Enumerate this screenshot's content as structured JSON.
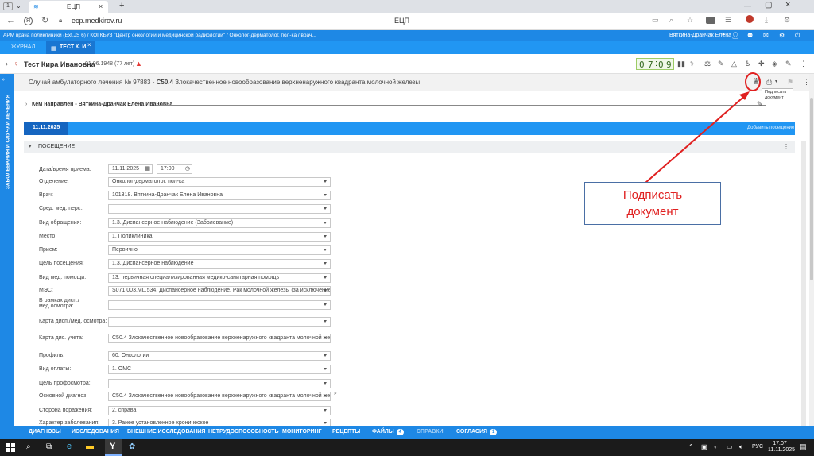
{
  "browser": {
    "tab_count": "1",
    "tab_title": "ЕЦП",
    "url": "ecp.medkirov.ru",
    "page_title": "ЕЦП"
  },
  "app_header": {
    "breadcrumb": "АРМ врача поликлиники (Ext.JS 6) / КОГКБУЗ \"Центр онкологии и медицинской радиологии\" / Онколог-дерматолог. пол-ка / врач...",
    "user": "Вяткина-Дранчак Елена"
  },
  "app_tabs": [
    {
      "label": "ЖУРНАЛ"
    },
    {
      "label": "ТЕСТ К. И."
    }
  ],
  "patient": {
    "name": "Тест Кира Ивановна",
    "birth": "01.06.1948 (77 лет)",
    "timer": [
      "0",
      "7",
      "0",
      "9"
    ]
  },
  "sidebar_label": "ЗАБОЛЕВАНИЯ И СЛУЧАИ ЛЕЧЕНИЯ",
  "case": {
    "title_prefix": "Случай амбулаторного лечения № 97883 - ",
    "diag_code": "C50.4",
    "title_rest": " Злокачественное новообразование верхненаружного квадранта молочной железы",
    "tooltip_line1": "Подписать",
    "tooltip_line2": "документ"
  },
  "referred": {
    "label": "Кем направлен - ",
    "value": "Вяткина-Дранчак Елена Ивановна"
  },
  "visit_bar": {
    "date_tab": "11.11.2025",
    "add_visit": "Добавить посещение"
  },
  "section_title": "ПОСЕЩЕНИЕ",
  "form": {
    "date_label": "Дата/время приема:",
    "date_value": "11.11.2025",
    "time_value": "17:00",
    "rows": [
      {
        "label": "Отделение:",
        "value": "Онколог-дерматолог. пол-ка"
      },
      {
        "label": "Врач:",
        "value": "101318. Вяткина-Дранчак Елена Ивановна"
      },
      {
        "label": "Сред. мед. перс.:",
        "value": ""
      },
      {
        "label": "Вид обращения:",
        "value": "1.3. Диспансерное наблюдение (Заболевание)"
      },
      {
        "label": "Место:",
        "value": "1. Поликлиника"
      },
      {
        "label": "Прием:",
        "value": "Первично"
      },
      {
        "label": "Цель посещения:",
        "value": "1.3. Диспансерное наблюдение"
      },
      {
        "label": "Вид мед. помощи:",
        "value": "13. первичная специализированная медико-санитарная помощь"
      },
      {
        "label": "МЭС:",
        "value": "S071.003.ML.534. Диспансерное наблюдение. Рак молочной железы (за исключением"
      },
      {
        "label": "В рамках дисп./",
        "label2": "мед.осмотра:",
        "value": ""
      },
      {
        "label": "Карта дисп./мед. осмотра:",
        "value": ""
      },
      {
        "label": "Карта дис. учета:",
        "value": "C50.4 Злокачественное новообразование верхненаружного квадранта молочной желе"
      },
      {
        "label": "Профиль:",
        "value": "60. Онкологии"
      },
      {
        "label": "Вид оплаты:",
        "value": "1. ОМС"
      },
      {
        "label": "Цель профосмотра:",
        "value": ""
      },
      {
        "label": "Основной диагноз:",
        "value": "C50.4 Злокачественное новообразование верхненаружного квадранта молочной желе"
      },
      {
        "label": "Сторона поражения:",
        "value": "2. справа"
      },
      {
        "label": "Характер заболевания:",
        "value": "3. Ранее установленное хроническое"
      }
    ]
  },
  "annotation": {
    "line1": "Подписать",
    "line2": "документ",
    "color": "#e02020"
  },
  "bottom_tabs": [
    {
      "label": "ДИАГНОЗЫ"
    },
    {
      "label": "ИССЛЕДОВАНИЯ"
    },
    {
      "label": "ВНЕШНИЕ ИССЛЕДОВАНИЯ"
    },
    {
      "label": "НЕТРУДОСПОСОБНОСТЬ"
    },
    {
      "label": "МОНИТОРИНГ"
    },
    {
      "label": "РЕЦЕПТЫ"
    },
    {
      "label": "ФАЙЛЫ",
      "badge": "4"
    },
    {
      "label": "СПРАВКИ"
    },
    {
      "label": "СОГЛАСИЯ",
      "badge": "1"
    }
  ],
  "taskbar": {
    "lang": "РУС",
    "time": "17:07",
    "date": "11.11.2025"
  }
}
